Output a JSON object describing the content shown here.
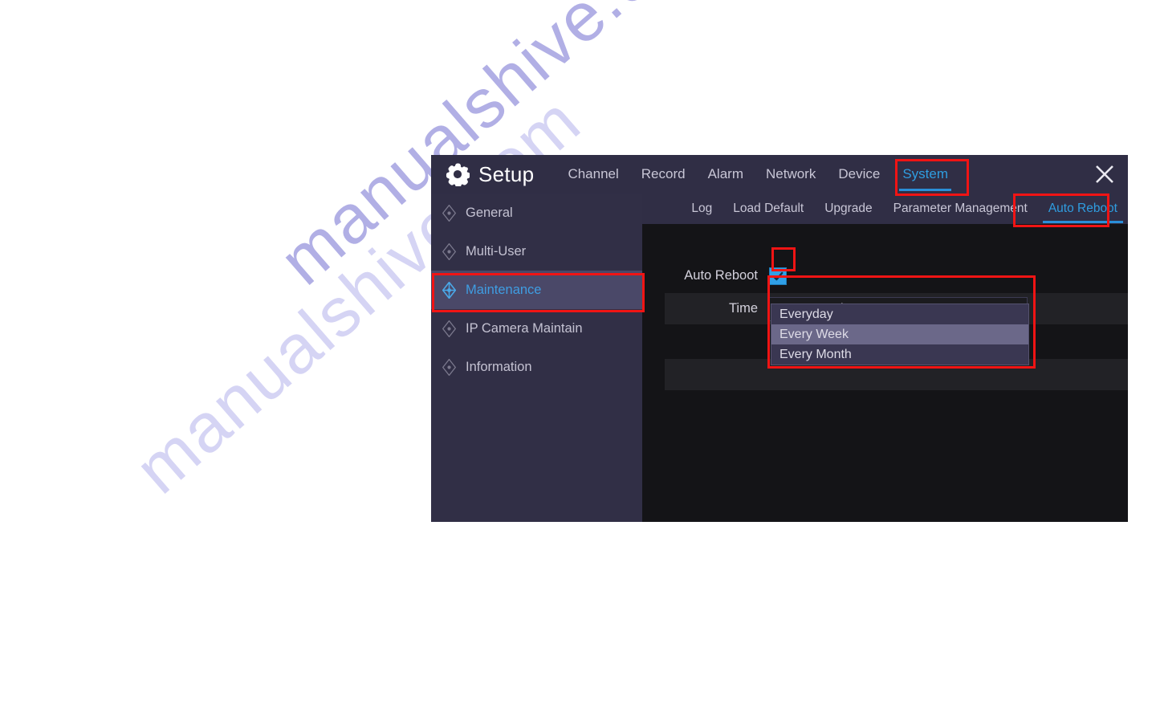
{
  "watermark": {
    "text": "manualshive.com"
  },
  "window": {
    "title": "Setup",
    "gear_icon": "gear-icon",
    "close_icon": "close-icon",
    "top_tabs": [
      {
        "label": "Channel",
        "active": false
      },
      {
        "label": "Record",
        "active": false
      },
      {
        "label": "Alarm",
        "active": false
      },
      {
        "label": "Network",
        "active": false
      },
      {
        "label": "Device",
        "active": false
      },
      {
        "label": "System",
        "active": true
      }
    ]
  },
  "sidebar": {
    "items": [
      {
        "label": "General",
        "icon": "diamond-icon",
        "active": false
      },
      {
        "label": "Multi-User",
        "icon": "diamond-icon",
        "active": false
      },
      {
        "label": "Maintenance",
        "icon": "diamond-icon",
        "active": true
      },
      {
        "label": "IP Camera Maintain",
        "icon": "diamond-icon",
        "active": false
      },
      {
        "label": "Information",
        "icon": "diamond-icon",
        "active": false
      }
    ]
  },
  "subnav": {
    "tabs": [
      {
        "label": "Log",
        "active": false
      },
      {
        "label": "Load Default",
        "active": false
      },
      {
        "label": "Upgrade",
        "active": false
      },
      {
        "label": "Parameter Management",
        "active": false
      },
      {
        "label": "Auto Reboot",
        "active": true
      }
    ]
  },
  "form": {
    "auto_reboot": {
      "label": "Auto Reboot",
      "checked": true,
      "check_icon": "check-icon"
    },
    "time": {
      "label": "Time",
      "value": "Every Week",
      "chevron_icon": "chevron-down-icon",
      "options": [
        {
          "label": "Everyday",
          "selected": false
        },
        {
          "label": "Every Week",
          "selected": true
        },
        {
          "label": "Every Month",
          "selected": false
        }
      ]
    }
  },
  "colors": {
    "accent_blue": "#2f9de0",
    "annotation_red": "#f01414",
    "titlebar": "#302e45",
    "sidebar": "#312f46",
    "sidebar_active": "#4a4868",
    "content_bg": "#141417",
    "row_stripe": "#222226",
    "checkbox": "#2fa0e8",
    "dropdown_bg": "#3a3752",
    "dropdown_selected": "#6b6889"
  }
}
